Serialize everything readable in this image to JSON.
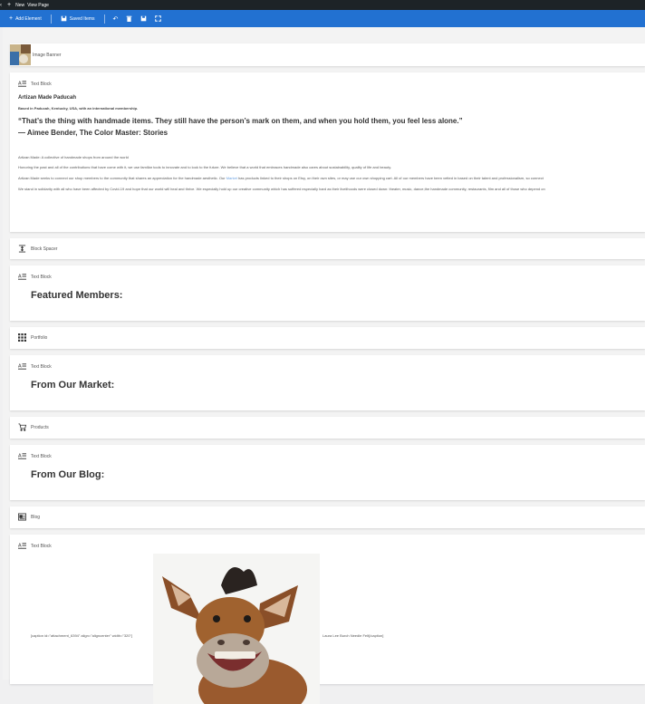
{
  "admin_bar": {
    "new_label": "New",
    "view_label": "View Page"
  },
  "toolbar": {
    "add_label": "Add Element",
    "saved_label": "Saved Items"
  },
  "blocks": {
    "banner": {
      "label": "Image Banner"
    },
    "text1": {
      "label": "Text Block",
      "title": "Artizan Made Paducah",
      "subtitle": "Based in Paducah, Kentucky, USA, with an international membership.",
      "quote1": "“That’s the thing with handmade items. They still have the person’s mark on them, and when you hold them, you feel less alone.”",
      "quote2": "— Aimee Bender, The Color Master: Stories",
      "p1": "Artizan Made: A collective of handmade shops from around the world",
      "p2": "Honoring the past and all of the contributions that have come with it, we use familiar tools to innovate and to look to the future. We believe that a world that embraces handmade also cares about sustainability, quality of life and beauty.",
      "p3a": "Artizan Made seeks to connect our shop members to the community that shares an appreciation for the handmade aesthetic. Our ",
      "p3link": "Market",
      "p3b": " has products linked to their shops on Etsy, on their own sites, or may use our own shopping cart. All of our members have been vetted in based on their talent and professionalism, so connect",
      "p4": "We stand in solidarity with all who have been affected by Covid-19 and hope that our world will heal and thrive. We especially hold up our creative community which has suffered especially hard as their livelihoods were closed down: theater, music, dance,the handmade community, restaurants, film and all of those who depend on"
    },
    "spacer": {
      "label": "Block Spacer"
    },
    "text2": {
      "label": "Text Block",
      "heading": "Featured Members:"
    },
    "portfolio": {
      "label": "Portfolio"
    },
    "text3": {
      "label": "Text Block",
      "heading": "From Our Market:"
    },
    "products": {
      "label": "Products"
    },
    "text4": {
      "label": "Text Block",
      "heading": "From Our Blog:"
    },
    "blog": {
      "label": "Blog"
    },
    "text5": {
      "label": "Text Block",
      "caption_code": "[caption id=\"attachment_6394\" align=\"aligncenter\" width=\"320\"]",
      "caption_text": "Laura Lee Burch Needle Felt[/caption]"
    }
  }
}
